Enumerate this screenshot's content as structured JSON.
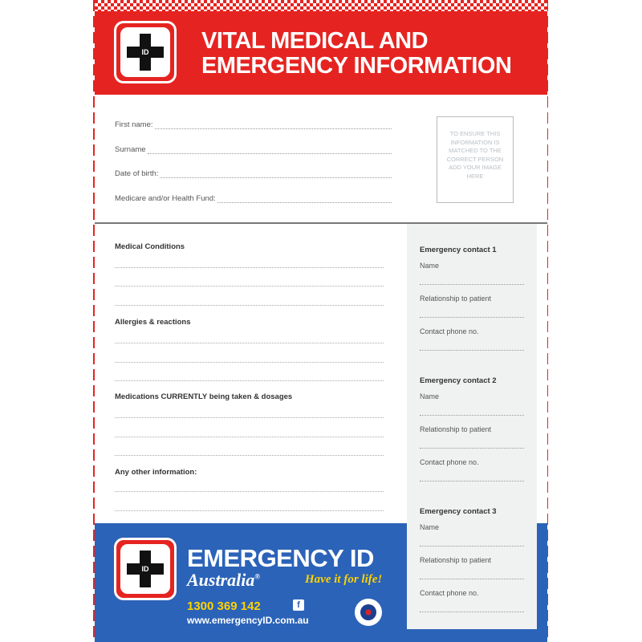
{
  "header": {
    "logo_text": "ID",
    "title_line1": "VITAL MEDICAL AND",
    "title_line2": "EMERGENCY INFORMATION"
  },
  "personal": {
    "first_name_label": "First name:",
    "surname_label": "Surname",
    "dob_label": "Date of birth:",
    "medicare_label": "Medicare and/or Health Fund:"
  },
  "photo_box": {
    "text": "TO ENSURE THIS INFORMATION IS MATCHED TO THE CORRECT PERSON ADD YOUR IMAGE HERE"
  },
  "sections": [
    {
      "title": "Medical Conditions"
    },
    {
      "title": "Allergies & reactions"
    },
    {
      "title": "Medications CURRENTLY being taken & dosages"
    },
    {
      "title": "Any other information:"
    }
  ],
  "contacts": [
    {
      "title": "Emergency contact 1",
      "name_label": "Name",
      "relationship_label": "Relationship to patient",
      "phone_label": "Contact phone no."
    },
    {
      "title": "Emergency contact 2",
      "name_label": "Name",
      "relationship_label": "Relationship to patient",
      "phone_label": "Contact phone no."
    },
    {
      "title": "Emergency contact 3",
      "name_label": "Name",
      "relationship_label": "Relationship to patient",
      "phone_label": "Contact phone no."
    }
  ],
  "footer": {
    "logo_text": "ID",
    "brand": "EMERGENCY ID",
    "country": "Australia",
    "trademark": "®",
    "tagline": "Have it for life!",
    "phone": "1300 369 142",
    "facebook_icon": "f",
    "website": "www.emergencyID.com.au"
  },
  "colors": {
    "header_red": "#e52421",
    "footer_blue": "#2b63b8",
    "accent_yellow": "#ffd200",
    "contacts_panel": "#f0f1f1"
  }
}
